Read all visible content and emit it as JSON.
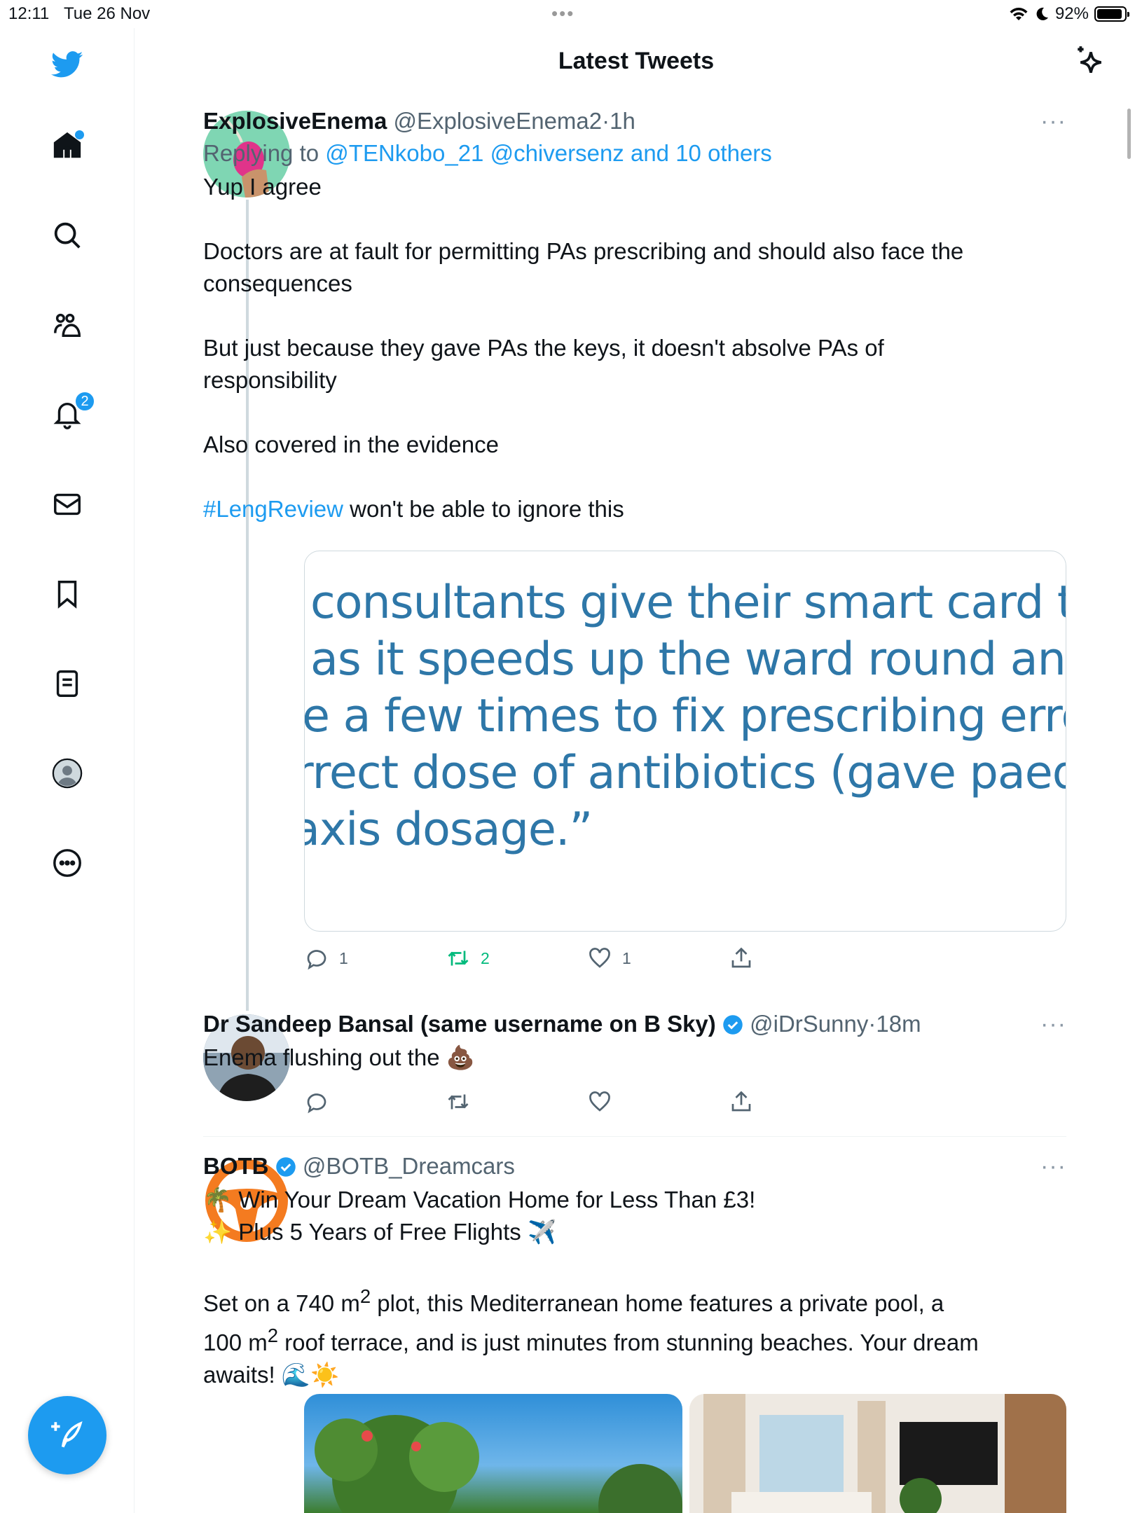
{
  "status_bar": {
    "time": "12:11",
    "date": "Tue 26 Nov",
    "battery": "92%",
    "battery_level": 0.92
  },
  "header": {
    "title": "Latest Tweets"
  },
  "sidebar": {
    "items": [
      {
        "name": "home",
        "has_dot": true
      },
      {
        "name": "search"
      },
      {
        "name": "communities"
      },
      {
        "name": "notifications",
        "badge": "2"
      },
      {
        "name": "messages"
      },
      {
        "name": "bookmarks"
      },
      {
        "name": "lists"
      },
      {
        "name": "profile"
      },
      {
        "name": "more"
      }
    ]
  },
  "tweets": [
    {
      "name": "ExplosiveEnema",
      "handle": "@ExplosiveEnema2",
      "dot": "·",
      "time": "1h",
      "replying_prefix": "Replying to",
      "replying_to": "@TENkobo_21 @chiversenz and 10 others",
      "paragraphs": [
        "Yup I agree",
        "Doctors are at fault for permitting PAs prescribing and should also face the consequences",
        "But just because they gave PAs the keys, it doesn't absolve PAs of responsibility",
        "Also covered in the evidence"
      ],
      "hashtag": "#LengReview",
      "hashtag_rest": " won't be able to ignore this",
      "image_lines": [
        "consultants give their smart card to th",
        "as it speeds up the ward round and pre",
        "e a few times to fix prescribing errors s",
        "rrect dose of antibiotics (gave paeds do",
        "axis dosage.”"
      ],
      "replies": "1",
      "retweets": "2",
      "likes": "1"
    },
    {
      "name": "Dr Sandeep Bansal (same username on B Sky)",
      "handle": "@iDrSunny",
      "dot": "·",
      "time": "18m",
      "text": "Enema flushing out the 💩"
    },
    {
      "name": "BOTB",
      "handle": "@BOTB_Dreamcars",
      "line1": "🌴 Win Your Dream Vacation Home for Less Than £3!",
      "line2": "✨ Plus 5 Years of Free Flights ✈️",
      "p1": "Set on a 740 m",
      "sup1": "2",
      "p2": " plot, this Mediterranean home features a private pool, a 100 m",
      "sup2": "2",
      "p3": " roof terrace, and is just minutes from stunning beaches. Your dream awaits! 🌊☀️"
    }
  ],
  "more_glyph": "···",
  "colors": {
    "accent": "#1d9bf0",
    "retweet": "#00ba7c",
    "secondary": "#536471"
  }
}
